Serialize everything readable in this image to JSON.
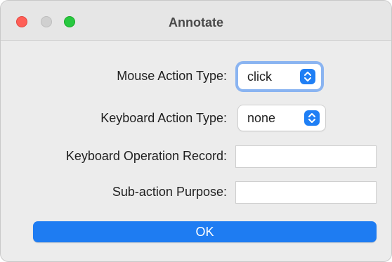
{
  "window": {
    "title": "Annotate"
  },
  "form": {
    "mouse_action_label": "Mouse Action Type:",
    "mouse_action_value": "click",
    "keyboard_action_label": "Keyboard Action Type:",
    "keyboard_action_value": "none",
    "keyboard_record_label": "Keyboard Operation Record:",
    "keyboard_record_value": "",
    "subaction_purpose_label": "Sub-action Purpose:",
    "subaction_purpose_value": ""
  },
  "buttons": {
    "ok_label": "OK"
  },
  "icons": {
    "close": "close-icon",
    "minimize": "minimize-icon",
    "zoom": "zoom-icon",
    "popup_arrows": "chevron-up-down-icon"
  },
  "colors": {
    "accent": "#1e7cf2",
    "close": "#ff5f57",
    "zoom": "#28c840",
    "window_bg": "#ececec"
  }
}
